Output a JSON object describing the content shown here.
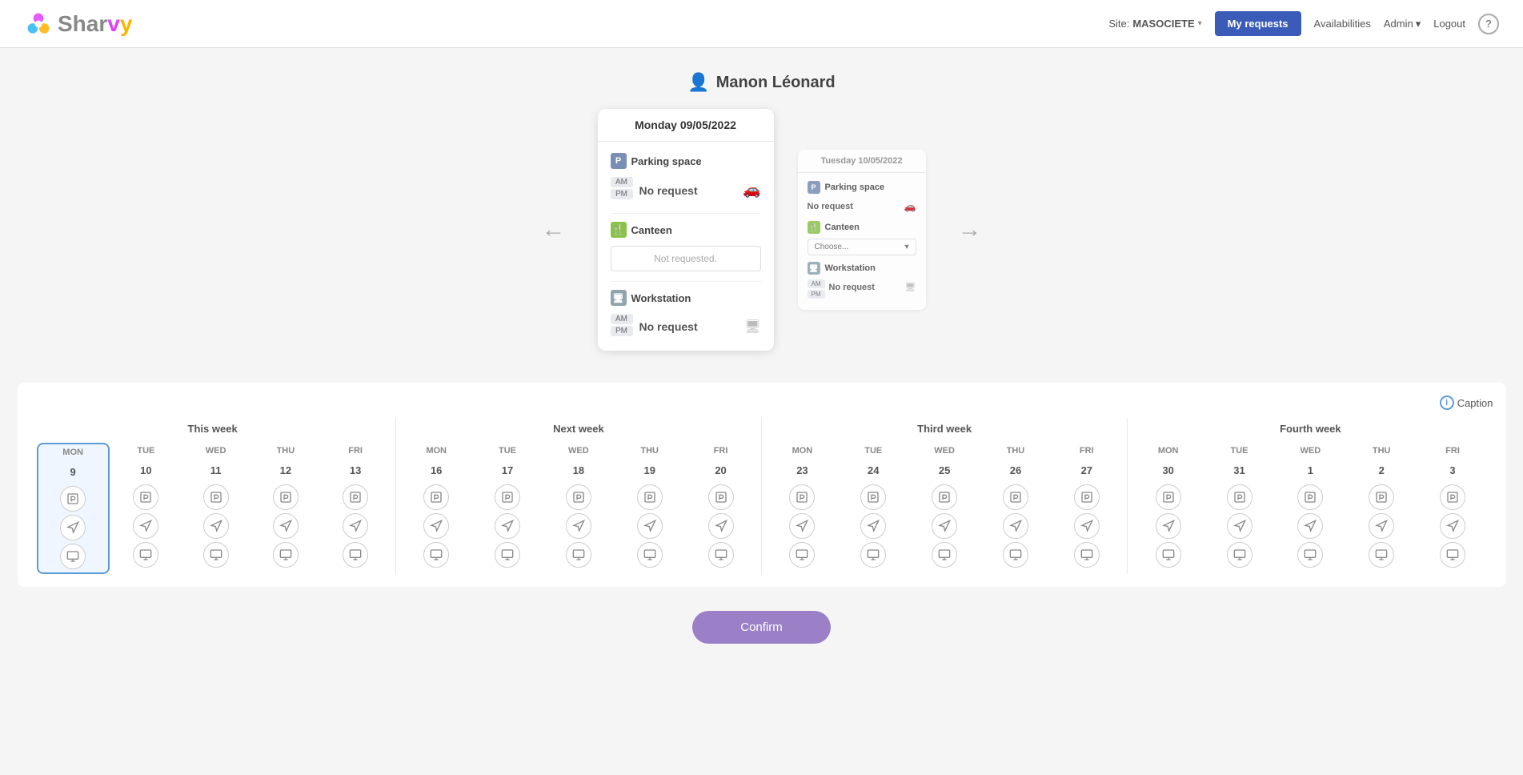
{
  "header": {
    "logo_text_sh": "Shar",
    "logo_text_ar": "v",
    "logo_text_vy": "y",
    "site_label": "Site:",
    "site_name": "MASOCIETE",
    "my_requests_label": "My requests",
    "availabilities_label": "Availabilities",
    "admin_label": "Admin",
    "admin_chevron": "▾",
    "logout_label": "Logout",
    "help_label": "?"
  },
  "user": {
    "name": "Manon Léonard",
    "avatar_symbol": "👤"
  },
  "nav_arrows": {
    "left": "←",
    "right": "→"
  },
  "main_card": {
    "date": "Monday 09/05/2022",
    "parking": {
      "label": "Parking space",
      "icon_letter": "P",
      "am_label": "AM",
      "pm_label": "PM",
      "status": "No request",
      "icon_symbol": "🚗"
    },
    "canteen": {
      "label": "Canteen",
      "icon_letter": "🍴",
      "status": "Not requested."
    },
    "workstation": {
      "label": "Workstation",
      "icon_letter": "W",
      "am_label": "AM",
      "pm_label": "PM",
      "status": "No request",
      "icon_symbol": "🖥"
    }
  },
  "secondary_card": {
    "date": "Tuesday 10/05/2022",
    "parking": {
      "label": "Parking space",
      "icon_letter": "P",
      "status": "No request",
      "icon_symbol": "🚗"
    },
    "canteen": {
      "label": "Canteen",
      "icon_letter": "🍴",
      "choose_label": "Choose...",
      "choose_chevron": "▾"
    },
    "workstation": {
      "label": "Workstation",
      "icon_letter": "W",
      "am_label": "AM",
      "pm_label": "PM",
      "status": "No request",
      "icon_symbol": "🖥"
    }
  },
  "calendar": {
    "caption_label": "Caption",
    "caption_icon": "i",
    "weeks": [
      {
        "label": "This week",
        "days": [
          {
            "name": "MON",
            "num": "9",
            "selected": true
          },
          {
            "name": "TUE",
            "num": "10",
            "selected": false
          },
          {
            "name": "WED",
            "num": "11",
            "selected": false
          },
          {
            "name": "THU",
            "num": "12",
            "selected": false
          },
          {
            "name": "FRI",
            "num": "13",
            "selected": false
          }
        ]
      },
      {
        "label": "Next week",
        "days": [
          {
            "name": "MON",
            "num": "16",
            "selected": false
          },
          {
            "name": "TUE",
            "num": "17",
            "selected": false
          },
          {
            "name": "WED",
            "num": "18",
            "selected": false
          },
          {
            "name": "THU",
            "num": "19",
            "selected": false
          },
          {
            "name": "FRI",
            "num": "20",
            "selected": false
          }
        ]
      },
      {
        "label": "Third week",
        "days": [
          {
            "name": "MON",
            "num": "23",
            "selected": false
          },
          {
            "name": "TUE",
            "num": "24",
            "selected": false
          },
          {
            "name": "WED",
            "num": "25",
            "selected": false
          },
          {
            "name": "THU",
            "num": "26",
            "selected": false
          },
          {
            "name": "FRI",
            "num": "27",
            "selected": false
          }
        ]
      },
      {
        "label": "Fourth week",
        "days": [
          {
            "name": "MON",
            "num": "30",
            "selected": false
          },
          {
            "name": "TUE",
            "num": "31",
            "selected": false
          },
          {
            "name": "WED",
            "num": "1",
            "selected": false
          },
          {
            "name": "THU",
            "num": "2",
            "selected": false
          },
          {
            "name": "FRI",
            "num": "3",
            "selected": false
          }
        ]
      }
    ]
  },
  "confirm": {
    "button_label": "Confirm"
  }
}
